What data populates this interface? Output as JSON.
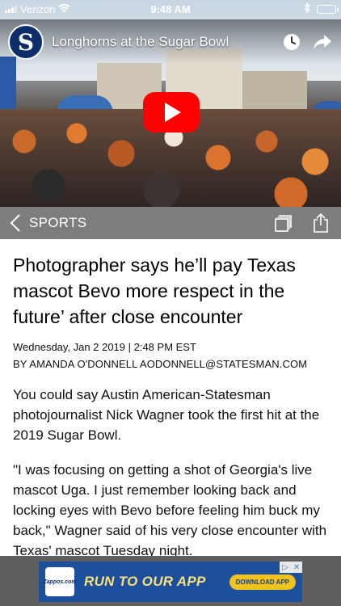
{
  "status_bar": {
    "carrier": "Verizon",
    "time": "9:48 AM"
  },
  "video": {
    "channel_initial": "S",
    "title": "Longhorns at the Sugar Bowl"
  },
  "section": {
    "label": "SPORTS"
  },
  "article": {
    "headline": "Photographer says he’ll pay Texas mascot Bevo more respect in the future’ after close encounter",
    "date": "Wednesday, Jan 2 2019 | 2:48 PM EST",
    "byline": "BY AMANDA O'DONNELL AODONNELL@STATESMAN.COM",
    "paragraphs": [
      "You could say Austin American-Statesman photojournalist Nick Wagner took the first hit at the 2019 Sugar Bowl.",
      "\"I was focusing on getting a shot of Georgia's live mascot Uga. I just remember looking back and locking eyes with Bevo before feeling him buck my back,\" Wagner said of his very close encounter with Texas' mascot Tuesday night."
    ]
  },
  "ad": {
    "logo_text": "Zappos.com",
    "headline": "RUN TO OUR APP",
    "cta": "DOWNLOAD APP"
  },
  "colors": {
    "section_bar": "#7d7d7d",
    "play_button": "#ff0000",
    "ad_background": "#1c4f9c",
    "ad_text": "#fbe07a"
  }
}
